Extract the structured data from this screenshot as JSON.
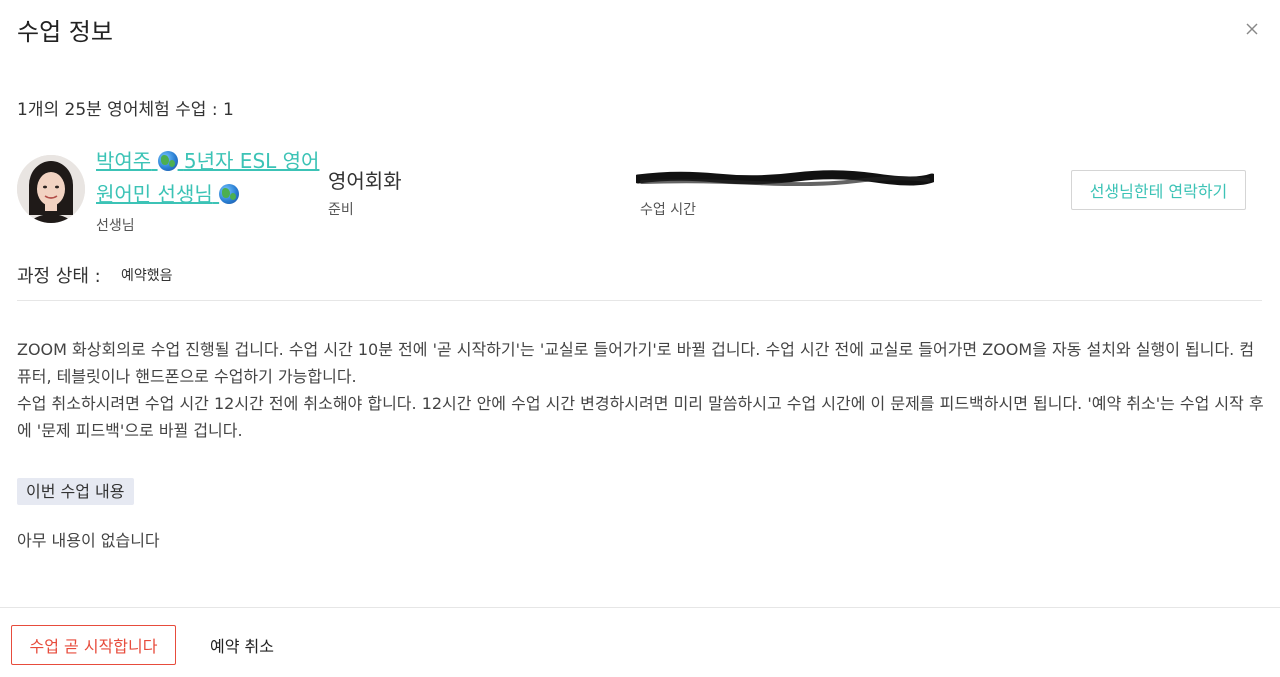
{
  "modal": {
    "title": "수업 정보",
    "close_icon": "close-icon"
  },
  "lesson": {
    "title": "1개의 25분 영어체험 수업 : 1"
  },
  "teacher": {
    "name_part1": "박여주",
    "name_part2": "5년자 ESL 영어 원어민 선생님",
    "globe_icon": "globe-emoji-icon",
    "role": "선생님",
    "avatar_icon": "teacher-avatar"
  },
  "course": {
    "name": "영어회화",
    "status": "준비"
  },
  "schedule": {
    "label": "수업 시간"
  },
  "buttons": {
    "contact": "선생님한테 연락하기",
    "start": "수업 곧 시작합니다",
    "cancel": "예약 취소"
  },
  "progress": {
    "label": "과정 상태 :",
    "value": "예약했음"
  },
  "notice": {
    "paragraph1": "ZOOM 화상회의로 수업 진행될 겁니다. 수업 시간 10분 전에 '곧 시작하기'는 '교실로 들어가기'로 바뀔 겁니다. 수업 시간 전에 교실로 들어가면 ZOOM을 자동 설치와 실행이 됩니다. 컴퓨터, 테블릿이나 핸드폰으로 수업하기 가능합니다.",
    "paragraph2": "수업 취소하시려면 수업 시간 12시간 전에 취소해야 합니다. 12시간 안에 수업 시간 변경하시려면 미리 말씀하시고 수업 시간에 이 문제를 피드백하시면 됩니다. '예약 취소'는 수업 시작 후에 '문제 피드백'으로 바뀔 겁니다."
  },
  "lesson_content": {
    "tag": "이번 수업 내용",
    "empty": "아무 내용이 없습니다"
  },
  "colors": {
    "accent": "#3cc3b6",
    "danger": "#e74c3c",
    "tag_bg": "#e6e9f2"
  }
}
